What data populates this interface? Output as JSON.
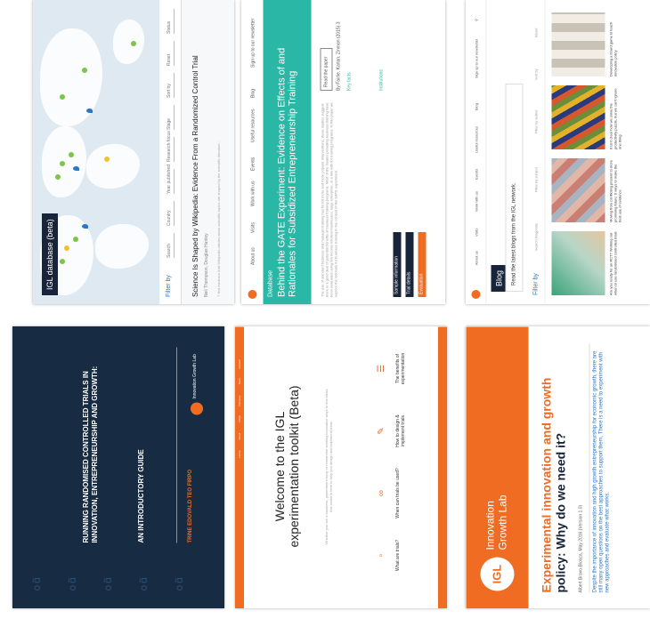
{
  "database": {
    "badge": "IGL database (beta)",
    "filter_label": "Filter by",
    "filters": [
      "Search",
      "Country",
      "Year published",
      "Research focus",
      "Stage",
      "Sort by",
      "Reset",
      "Status"
    ],
    "study_title": "Science Is Shaped by Wikipedia: Evidence From a Randomized Control Trial",
    "study_meta": "Neil Thompson, Douglas Hanley",
    "study_desc": "\"I find evidence that Wikipedia articles about scientific topics are shaped by the scientific literature..."
  },
  "gate": {
    "nav": [
      "About us",
      "Visits",
      "Work with us",
      "Events",
      "Useful resources",
      "Blog"
    ],
    "nav_cta": "Sign up to our newsletter",
    "kicker": "Database",
    "headline": "Behind the GATE Experiment: Evidence on Effects of and Rationales for Subsidized Entrepreneurship Training",
    "body": "The use of standard business and manager training has found more and more popular interventions, these studies suggest there is a good deal of potential benefits of business training programs. Most of the studies providing business training have been evaluated using low income informal businesses, large enterprise, or a mix with for training programs. In this paper we explore the rationale for business training in the context of the GATE experiment.",
    "buttons": [
      "Sample information",
      "Trial details",
      "Evaluation"
    ],
    "read_paper": "Read the paper",
    "authors": "By Fairlie, Karlan, Zinman (2015) 3",
    "key_facts_label": "Key facts",
    "institutions_label": "Institutions",
    "accent_color": "#2ab7a5"
  },
  "blog": {
    "nav": [
      "About us",
      "Visits",
      "Work with us",
      "Events",
      "Useful resources",
      "Blog"
    ],
    "nav_cta": "Sign up to our newsletter",
    "badge": "Blog",
    "subtitle": "Read the latest blogs from the IGL network.",
    "filter_label": "Filter by",
    "filters": [
      "Search blogposts",
      "Filter by subject",
      "Filter by author",
      "Sort by",
      "Reset"
    ],
    "cards": [
      {
        "caption": "Are you ready for an RCT? Working out when to use randomised controlled trials"
      },
      {
        "caption": "Moving from conflicting present to more promising future: 6 ways to make the best use of evidence"
      },
      {
        "caption": "It isn't clear how we solve the productivity puzzle, but we can't ignore one thing"
      },
      {
        "caption": "Developing a board game to teach innovation policy"
      }
    ]
  },
  "guide": {
    "title": "RUNNING RANDOMISED CONTROLLED TRIALS IN INNOVATION, ENTREPRENEURSHIP AND GROWTH:",
    "subtitle": "AN INTRODUCTORY GUIDE",
    "authors": "TRINE EDOVALD TEO FIRPO",
    "brand": "Innovation Growth Lab",
    "mark": "IGL"
  },
  "toolkit": {
    "nav": [
      "Home",
      "About",
      "FAQs",
      "Glossary",
      "Team",
      "Contact"
    ],
    "title": "Welcome to the IGL experimentation toolkit (Beta)",
    "subtitle": "Whether you are a business, government body or researcher seeking innovative ways to test ideas, this toolkit is here to help you design and implement trials.",
    "steps": [
      "What are trials?",
      "When can trials be used?",
      "How to design & implement trials",
      "The benefits of experimentation"
    ]
  },
  "article": {
    "brand_mark": "IGL",
    "brand_line1": "Innovation",
    "brand_line2": "Growth Lab",
    "title_orange": "Experimental innovation and growth",
    "title_dark": "policy: Why do we need it?",
    "byline": "Albert Bravo-Biosca, May 2016 (Version 1.0)",
    "lede": "Despite the importance of innovation and high growth entrepreneurship for economic growth, there are still many open questions on the best approaches to support them. There is a need to experiment with new approaches and evaluate what works.",
    "accent_color": "#ef6c22"
  }
}
